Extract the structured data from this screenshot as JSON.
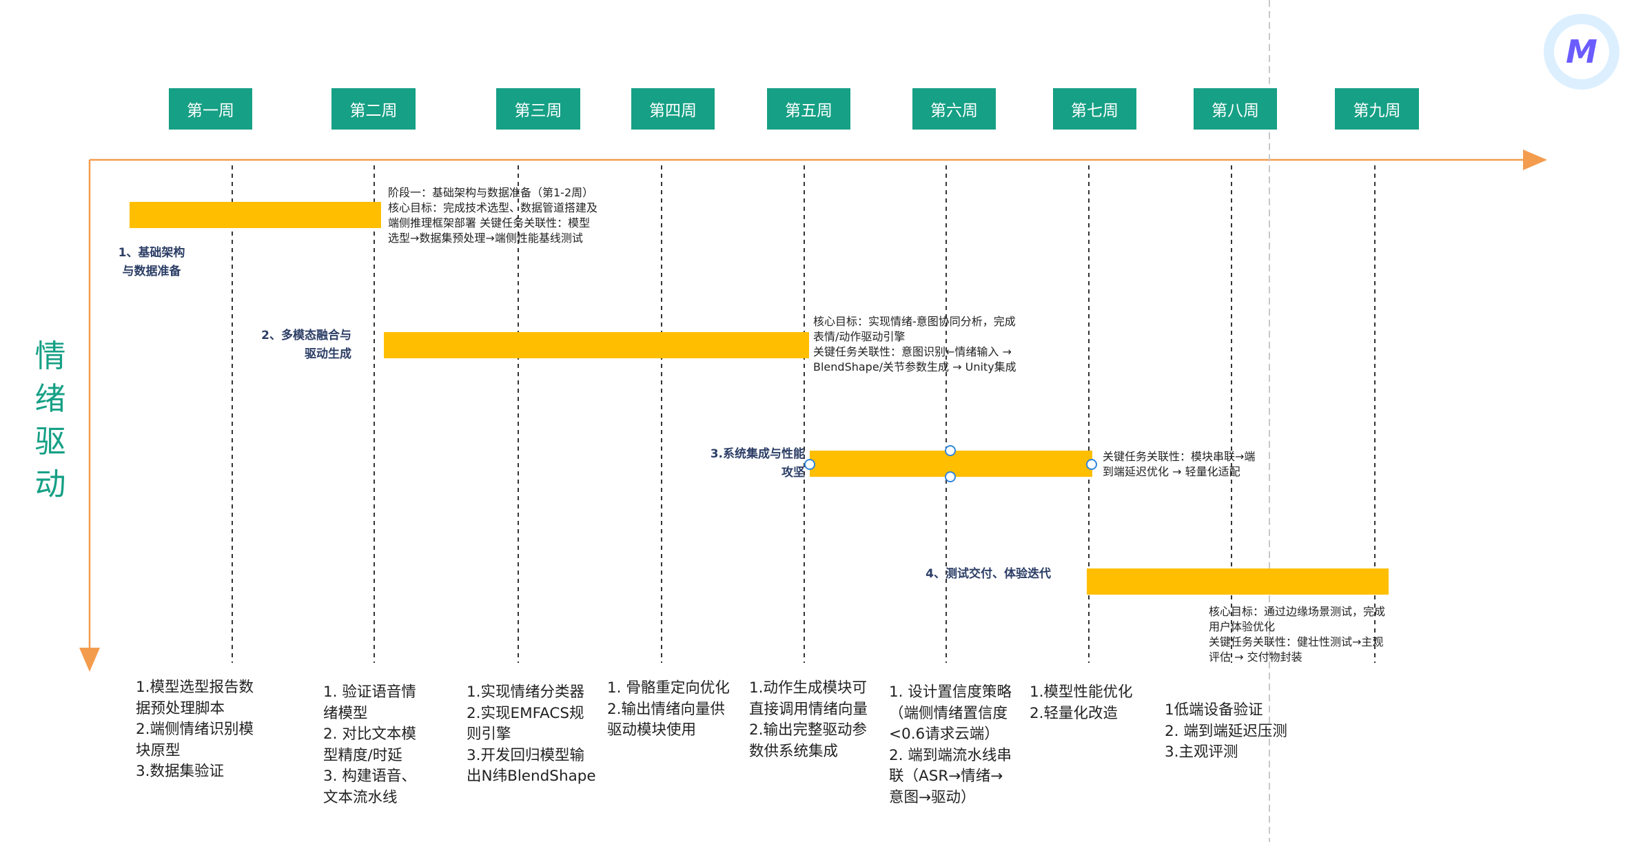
{
  "title": "情绪驱动",
  "weeks": [
    "第一周",
    "第二周",
    "第三周",
    "第四周",
    "第五周",
    "第六周",
    "第七周",
    "第八周",
    "第九周"
  ],
  "phases": [
    {
      "label_line1": "1、基础架构",
      "label_line2": "与数据准备",
      "note": [
        "阶段一：基础架构与数据准备（第1-2周）",
        "核心目标：完成技术选型、数据管道搭建及",
        "端侧推理框架部署 关键任务关联性：模型",
        "选型→数据集预处理→端侧性能基线测试"
      ]
    },
    {
      "label_line1": "2、多模态融合与",
      "label_line2": "驱动生成",
      "note": [
        "核心目标：实现情绪-意图协同分析，完成",
        "表情/动作驱动引擎",
        "关键任务关联性：意图识别←情绪输入 →",
        "BlendShape/关节参数生成 → Unity集成"
      ]
    },
    {
      "label_line1": "3.系统集成与性能",
      "label_line2": "攻坚",
      "note": [
        "关键任务关联性：模块串联→端",
        "到端延迟优化 → 轻量化适配"
      ]
    },
    {
      "label_line1": "4、测试交付、体验迭代",
      "label_line2": "",
      "note": [
        "核心目标：通过边缘场景测试，完成",
        "用户体验优化",
        "关键任务关联性：健壮性测试→主观",
        "评估 → 交付物封装"
      ]
    }
  ],
  "tasks": [
    [
      "1.模型选型报告数",
      "据预处理脚本",
      "2.端侧情绪识别模",
      "块原型",
      "3.数据集验证"
    ],
    [
      "1. 验证语音情",
      "绪模型",
      "2. 对比文本模",
      "型精度/时延",
      "3. 构建语音、",
      "文本流水线"
    ],
    [
      "1.实现情绪分类器",
      "2.实现EMFACS规",
      "则引擎",
      "3.开发回归模型输",
      "出N纬BlendShape"
    ],
    [
      "1. 骨骼重定向优化",
      "2.输出情绪向量供",
      "驱动模块使用"
    ],
    [
      "1.动作生成模块可",
      "直接调用情绪向量",
      "2.输出完整驱动参",
      "数供系统集成"
    ],
    [
      "1. 设计置信度策略",
      "（端侧情绪置信度",
      "<0.6请求云端）",
      "2. 端到端流水线串",
      "联（ASR→情绪→",
      "意图→驱动）"
    ],
    [
      "1.模型性能优化",
      "2.轻量化改造"
    ],
    [
      "1低端设备验证",
      "2. 端到端延迟压测",
      "3.主观评测"
    ]
  ],
  "colors": {
    "accent": "#16a085",
    "bar": "#ffbe00",
    "axis": "#f39c4e",
    "phase_label": "#2c3e66"
  },
  "icons": [
    "app-logo-icon"
  ]
}
